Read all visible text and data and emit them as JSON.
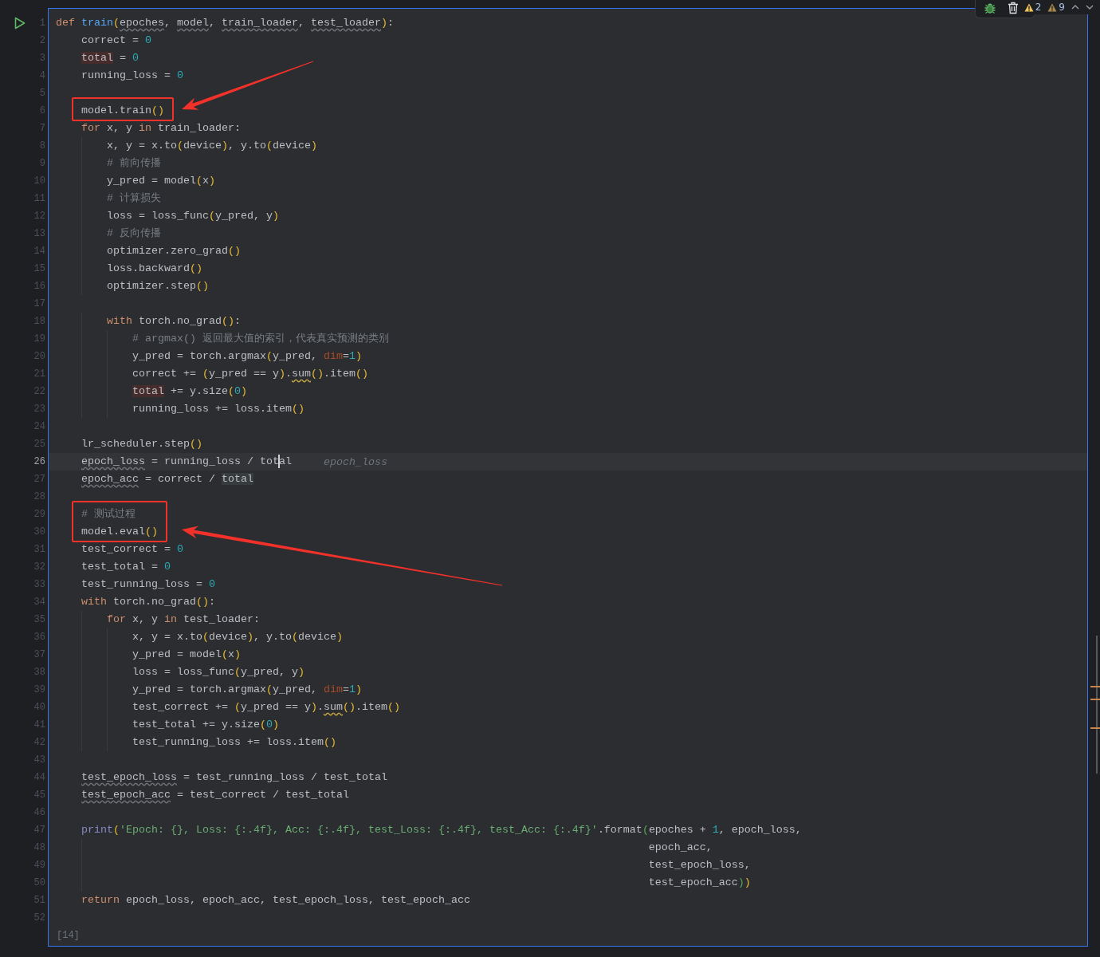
{
  "toolbar": {
    "inspections": [
      {
        "kind": "warning",
        "count": "2"
      },
      {
        "kind": "weak",
        "count": "9"
      }
    ]
  },
  "cell": {
    "execution_count": "[14]",
    "lines": [
      {
        "number": "1",
        "current": false,
        "marked": false,
        "segments": [
          {
            "kind": "keyword",
            "text": "def "
          },
          {
            "kind": "defname",
            "text": "train"
          },
          {
            "kind": "paren",
            "text": "("
          },
          {
            "kind": "weak",
            "text": "epoches"
          },
          {
            "kind": "plain",
            "text": ", "
          },
          {
            "kind": "weak",
            "text": "model"
          },
          {
            "kind": "plain",
            "text": ", "
          },
          {
            "kind": "weak",
            "text": "train_loader"
          },
          {
            "kind": "plain",
            "text": ", "
          },
          {
            "kind": "weak",
            "text": "test_loader"
          },
          {
            "kind": "paren",
            "text": ")"
          },
          {
            "kind": "plain",
            "text": ":"
          }
        ]
      },
      {
        "number": "2",
        "current": false,
        "marked": false,
        "segments": [
          {
            "kind": "plain",
            "text": "    correct = "
          },
          {
            "kind": "number",
            "text": "0"
          }
        ]
      },
      {
        "number": "3",
        "current": false,
        "marked": false,
        "segments": [
          {
            "kind": "write",
            "text": "    total"
          },
          {
            "kind": "plain",
            "text": " = "
          },
          {
            "kind": "number",
            "text": "0"
          }
        ]
      },
      {
        "number": "4",
        "current": false,
        "marked": false,
        "segments": [
          {
            "kind": "plain",
            "text": "    running_loss = "
          },
          {
            "kind": "number",
            "text": "0"
          }
        ]
      },
      {
        "number": "5",
        "current": false,
        "marked": false
      },
      {
        "number": "6",
        "current": false,
        "marked": true,
        "segments": [
          {
            "kind": "plain",
            "text": "    model.train"
          },
          {
            "kind": "paren",
            "text": "()"
          }
        ]
      },
      {
        "number": "7",
        "current": false,
        "marked": false,
        "segments": [
          {
            "kind": "keyword",
            "text": "    for"
          },
          {
            "kind": "plain",
            "text": " x, y "
          },
          {
            "kind": "keyword",
            "text": "in"
          },
          {
            "kind": "plain",
            "text": " train_loader:"
          }
        ]
      },
      {
        "number": "8",
        "current": false,
        "marked": false,
        "segments": [
          {
            "kind": "plain",
            "text": "        x, y = x.to"
          },
          {
            "kind": "paren",
            "text": "("
          },
          {
            "kind": "plain",
            "text": "device"
          },
          {
            "kind": "paren",
            "text": ")"
          },
          {
            "kind": "plain",
            "text": ", y.to"
          },
          {
            "kind": "paren",
            "text": "("
          },
          {
            "kind": "plain",
            "text": "device"
          },
          {
            "kind": "paren",
            "text": ")"
          }
        ]
      },
      {
        "number": "9",
        "current": false,
        "marked": false,
        "segments": [
          {
            "kind": "comment",
            "text": "        # 前向传播"
          }
        ]
      },
      {
        "number": "10",
        "current": false,
        "marked": false,
        "segments": [
          {
            "kind": "plain",
            "text": "        y_pred = model"
          },
          {
            "kind": "paren",
            "text": "("
          },
          {
            "kind": "plain",
            "text": "x"
          },
          {
            "kind": "paren",
            "text": ")"
          }
        ]
      },
      {
        "number": "11",
        "current": false,
        "marked": false,
        "segments": [
          {
            "kind": "comment",
            "text": "        # 计算损失"
          }
        ]
      },
      {
        "number": "12",
        "current": false,
        "marked": false,
        "segments": [
          {
            "kind": "plain",
            "text": "        loss = loss_func"
          },
          {
            "kind": "paren",
            "text": "("
          },
          {
            "kind": "plain",
            "text": "y_pred, y"
          },
          {
            "kind": "paren",
            "text": ")"
          }
        ]
      },
      {
        "number": "13",
        "current": false,
        "marked": false,
        "segments": [
          {
            "kind": "comment",
            "text": "        # 反向传播"
          }
        ]
      },
      {
        "number": "14",
        "current": false,
        "marked": false,
        "segments": [
          {
            "kind": "plain",
            "text": "        optimizer.zero_grad"
          },
          {
            "kind": "paren",
            "text": "()"
          }
        ]
      },
      {
        "number": "15",
        "current": false,
        "marked": false,
        "segments": [
          {
            "kind": "plain",
            "text": "        loss.backward"
          },
          {
            "kind": "paren",
            "text": "()"
          }
        ]
      },
      {
        "number": "16",
        "current": false,
        "marked": false,
        "segments": [
          {
            "kind": "plain",
            "text": "        optimizer.step"
          },
          {
            "kind": "paren",
            "text": "()"
          }
        ]
      },
      {
        "number": "17",
        "current": false,
        "marked": false
      },
      {
        "number": "18",
        "current": false,
        "marked": false,
        "segments": [
          {
            "kind": "keyword",
            "text": "        with"
          },
          {
            "kind": "plain",
            "text": " torch.no_grad"
          },
          {
            "kind": "paren",
            "text": "()"
          },
          {
            "kind": "plain",
            "text": ":"
          }
        ]
      },
      {
        "number": "19",
        "current": false,
        "marked": false,
        "segments": [
          {
            "kind": "comment",
            "text": "            # argmax() 返回最大值的索引，代表真实预测的类别"
          }
        ]
      },
      {
        "number": "20",
        "current": false,
        "marked": false,
        "segments": [
          {
            "kind": "plain",
            "text": "            y_pred = torch.argmax"
          },
          {
            "kind": "paren",
            "text": "("
          },
          {
            "kind": "plain",
            "text": "y_pred, "
          },
          {
            "kind": "kwarg",
            "text": "dim"
          },
          {
            "kind": "plain",
            "text": "="
          },
          {
            "kind": "number",
            "text": "1"
          },
          {
            "kind": "paren",
            "text": ")"
          }
        ]
      },
      {
        "number": "21",
        "current": false,
        "marked": false,
        "segments": [
          {
            "kind": "plain",
            "text": "            correct += "
          },
          {
            "kind": "paren",
            "text": "("
          },
          {
            "kind": "plain",
            "text": "y_pred == y"
          },
          {
            "kind": "paren",
            "text": ")"
          },
          {
            "kind": "plain",
            "text": "."
          },
          {
            "kind": "warn",
            "text": "sum"
          },
          {
            "kind": "paren",
            "text": "()"
          },
          {
            "kind": "plain",
            "text": ".item"
          },
          {
            "kind": "paren",
            "text": "()"
          }
        ]
      },
      {
        "number": "22",
        "current": false,
        "marked": false,
        "segments": [
          {
            "kind": "write",
            "text": "            total"
          },
          {
            "kind": "plain",
            "text": " += y.size"
          },
          {
            "kind": "paren",
            "text": "("
          },
          {
            "kind": "number",
            "text": "0"
          },
          {
            "kind": "paren",
            "text": ")"
          }
        ]
      },
      {
        "number": "23",
        "current": false,
        "marked": false,
        "segments": [
          {
            "kind": "plain",
            "text": "            running_loss += loss.item"
          },
          {
            "kind": "paren",
            "text": "()"
          }
        ]
      },
      {
        "number": "24",
        "current": false,
        "marked": false
      },
      {
        "number": "25",
        "current": false,
        "marked": false,
        "segments": [
          {
            "kind": "plain",
            "text": "    lr_scheduler.step"
          },
          {
            "kind": "paren",
            "text": "()"
          }
        ]
      },
      {
        "number": "26",
        "current": true,
        "marked": false,
        "hint": "epoch_loss",
        "segments": [
          {
            "kind": "weak",
            "text": "    epoch_loss"
          },
          {
            "kind": "plain",
            "text": " = running_loss / tot"
          },
          {
            "kind": "caret"
          },
          {
            "kind": "plain",
            "text": "al"
          }
        ]
      },
      {
        "number": "27",
        "current": false,
        "marked": false,
        "segments": [
          {
            "kind": "weak",
            "text": "    epoch_acc"
          },
          {
            "kind": "plain",
            "text": " = correct / "
          },
          {
            "kind": "read",
            "text": "total"
          }
        ]
      },
      {
        "number": "28",
        "current": false,
        "marked": false
      },
      {
        "number": "29",
        "current": false,
        "marked": true,
        "segments": [
          {
            "kind": "comment",
            "text": "    # 测试过程"
          }
        ]
      },
      {
        "number": "30",
        "current": false,
        "marked": true,
        "segments": [
          {
            "kind": "plain",
            "text": "    model.eval"
          },
          {
            "kind": "paren",
            "text": "()"
          }
        ]
      },
      {
        "number": "31",
        "current": false,
        "marked": false,
        "segments": [
          {
            "kind": "plain",
            "text": "    test_correct = "
          },
          {
            "kind": "number",
            "text": "0"
          }
        ]
      },
      {
        "number": "32",
        "current": false,
        "marked": false,
        "segments": [
          {
            "kind": "plain",
            "text": "    test_total = "
          },
          {
            "kind": "number",
            "text": "0"
          }
        ]
      },
      {
        "number": "33",
        "current": false,
        "marked": false,
        "segments": [
          {
            "kind": "plain",
            "text": "    test_running_loss = "
          },
          {
            "kind": "number",
            "text": "0"
          }
        ]
      },
      {
        "number": "34",
        "current": false,
        "marked": false,
        "segments": [
          {
            "kind": "keyword",
            "text": "    with"
          },
          {
            "kind": "plain",
            "text": " torch.no_grad"
          },
          {
            "kind": "paren",
            "text": "()"
          },
          {
            "kind": "plain",
            "text": ":"
          }
        ]
      },
      {
        "number": "35",
        "current": false,
        "marked": false,
        "segments": [
          {
            "kind": "keyword",
            "text": "        for"
          },
          {
            "kind": "plain",
            "text": " x, y "
          },
          {
            "kind": "keyword",
            "text": "in"
          },
          {
            "kind": "plain",
            "text": " test_loader:"
          }
        ]
      },
      {
        "number": "36",
        "current": false,
        "marked": false,
        "segments": [
          {
            "kind": "plain",
            "text": "            x, y = x.to"
          },
          {
            "kind": "paren",
            "text": "("
          },
          {
            "kind": "plain",
            "text": "device"
          },
          {
            "kind": "paren",
            "text": ")"
          },
          {
            "kind": "plain",
            "text": ", y.to"
          },
          {
            "kind": "paren",
            "text": "("
          },
          {
            "kind": "plain",
            "text": "device"
          },
          {
            "kind": "paren",
            "text": ")"
          }
        ]
      },
      {
        "number": "37",
        "current": false,
        "marked": false,
        "segments": [
          {
            "kind": "plain",
            "text": "            y_pred = model"
          },
          {
            "kind": "paren",
            "text": "("
          },
          {
            "kind": "plain",
            "text": "x"
          },
          {
            "kind": "paren",
            "text": ")"
          }
        ]
      },
      {
        "number": "38",
        "current": false,
        "marked": false,
        "segments": [
          {
            "kind": "plain",
            "text": "            loss = loss_func"
          },
          {
            "kind": "paren",
            "text": "("
          },
          {
            "kind": "plain",
            "text": "y_pred, y"
          },
          {
            "kind": "paren",
            "text": ")"
          }
        ]
      },
      {
        "number": "39",
        "current": false,
        "marked": false,
        "segments": [
          {
            "kind": "plain",
            "text": "            y_pred = torch.argmax"
          },
          {
            "kind": "paren",
            "text": "("
          },
          {
            "kind": "plain",
            "text": "y_pred, "
          },
          {
            "kind": "kwarg",
            "text": "dim"
          },
          {
            "kind": "plain",
            "text": "="
          },
          {
            "kind": "number",
            "text": "1"
          },
          {
            "kind": "paren",
            "text": ")"
          }
        ]
      },
      {
        "number": "40",
        "current": false,
        "marked": false,
        "segments": [
          {
            "kind": "plain",
            "text": "            test_correct += "
          },
          {
            "kind": "paren",
            "text": "("
          },
          {
            "kind": "plain",
            "text": "y_pred == y"
          },
          {
            "kind": "paren",
            "text": ")"
          },
          {
            "kind": "plain",
            "text": "."
          },
          {
            "kind": "warn",
            "text": "sum"
          },
          {
            "kind": "paren",
            "text": "()"
          },
          {
            "kind": "plain",
            "text": ".item"
          },
          {
            "kind": "paren",
            "text": "()"
          }
        ]
      },
      {
        "number": "41",
        "current": false,
        "marked": false,
        "segments": [
          {
            "kind": "plain",
            "text": "            test_total += y.size"
          },
          {
            "kind": "paren",
            "text": "("
          },
          {
            "kind": "number",
            "text": "0"
          },
          {
            "kind": "paren",
            "text": ")"
          }
        ]
      },
      {
        "number": "42",
        "current": false,
        "marked": false,
        "segments": [
          {
            "kind": "plain",
            "text": "            test_running_loss += loss.item"
          },
          {
            "kind": "paren",
            "text": "()"
          }
        ]
      },
      {
        "number": "43",
        "current": false,
        "marked": false
      },
      {
        "number": "44",
        "current": false,
        "marked": false,
        "segments": [
          {
            "kind": "weak",
            "text": "    test_epoch_loss"
          },
          {
            "kind": "plain",
            "text": " = test_running_loss / test_total"
          }
        ]
      },
      {
        "number": "45",
        "current": false,
        "marked": false,
        "segments": [
          {
            "kind": "weak",
            "text": "    test_epoch_acc"
          },
          {
            "kind": "plain",
            "text": " = test_correct / test_total"
          }
        ]
      },
      {
        "number": "46",
        "current": false,
        "marked": false
      },
      {
        "number": "47",
        "current": false,
        "marked": false,
        "segments": [
          {
            "kind": "builtin",
            "text": "    print"
          },
          {
            "kind": "paren",
            "text": "("
          },
          {
            "kind": "string",
            "text": "'Epoch: {}, Loss: {:.4f}, Acc: {:.4f}, test_Loss: {:.4f}, test_Acc: {:.4f}'"
          },
          {
            "kind": "plain",
            "text": ".format"
          },
          {
            "kind": "paren2",
            "text": "("
          },
          {
            "kind": "plain",
            "text": "epoches + "
          },
          {
            "kind": "number",
            "text": "1"
          },
          {
            "kind": "plain",
            "text": ", epoch_loss,"
          }
        ]
      },
      {
        "number": "48",
        "current": false,
        "marked": false,
        "segments": [
          {
            "kind": "plain",
            "text": "                                                                                             epoch_acc,"
          }
        ]
      },
      {
        "number": "49",
        "current": false,
        "marked": false,
        "segments": [
          {
            "kind": "plain",
            "text": "                                                                                             test_epoch_loss,"
          }
        ]
      },
      {
        "number": "50",
        "current": false,
        "marked": false,
        "segments": [
          {
            "kind": "plain",
            "text": "                                                                                             test_epoch_acc"
          },
          {
            "kind": "paren2",
            "text": ")"
          },
          {
            "kind": "paren",
            "text": ")"
          }
        ]
      },
      {
        "number": "51",
        "current": false,
        "marked": false,
        "segments": [
          {
            "kind": "keyword",
            "text": "    return"
          },
          {
            "kind": "plain",
            "text": " epoch_loss, epoch_acc, test_epoch_loss, test_epoch_acc"
          }
        ]
      },
      {
        "number": "52",
        "current": false,
        "marked": false
      }
    ]
  }
}
